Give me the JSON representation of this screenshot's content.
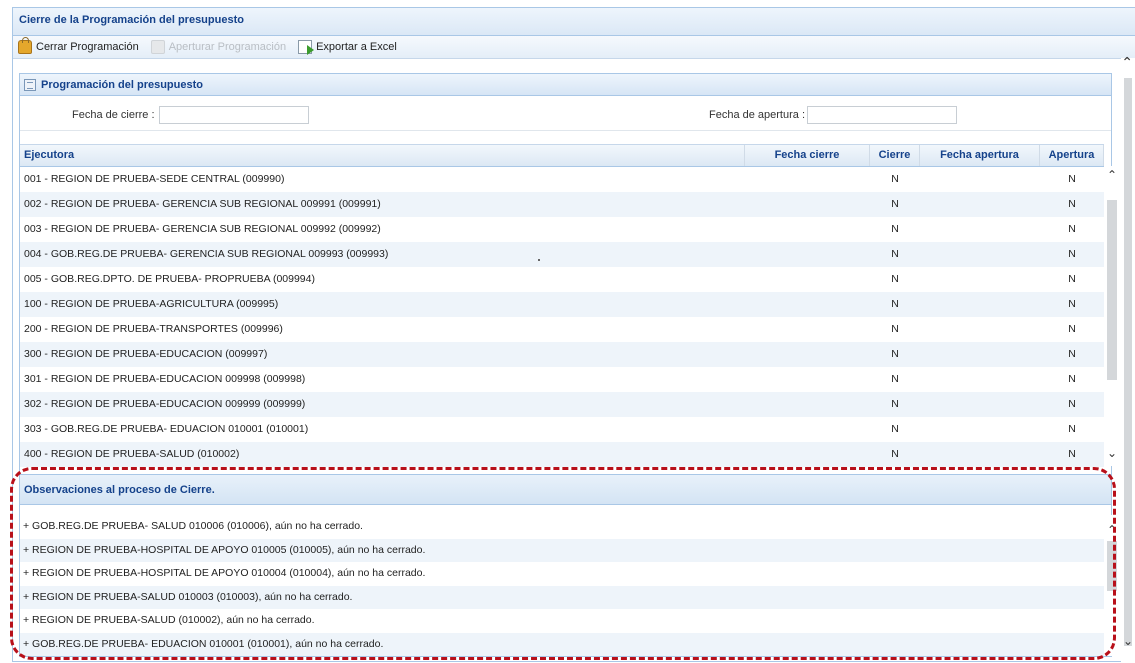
{
  "window": {
    "title": "Cierre de la Programación del presupuesto"
  },
  "toolbar": {
    "cerrar": "Cerrar Programación",
    "aperturar": "Aperturar Programación",
    "exportar": "Exportar a Excel"
  },
  "panel": {
    "title": "Programación del presupuesto"
  },
  "dates": {
    "cierre_label": "Fecha de cierre :",
    "cierre_value": "",
    "apertura_label": "Fecha de apertura :",
    "apertura_value": ""
  },
  "grid": {
    "columns": [
      "Ejecutora",
      "Fecha cierre",
      "Cierre",
      "Fecha apertura",
      "Apertura"
    ],
    "rows": [
      {
        "ejecutora": "001 - REGION DE PRUEBA-SEDE CENTRAL (009990)",
        "fecha_cierre": "",
        "cierre": "N",
        "fecha_apertura": "",
        "apertura": "N"
      },
      {
        "ejecutora": "002 - REGION DE PRUEBA- GERENCIA SUB REGIONAL 009991 (009991)",
        "fecha_cierre": "",
        "cierre": "N",
        "fecha_apertura": "",
        "apertura": "N"
      },
      {
        "ejecutora": "003 - REGION DE PRUEBA- GERENCIA SUB REGIONAL 009992 (009992)",
        "fecha_cierre": "",
        "cierre": "N",
        "fecha_apertura": "",
        "apertura": "N"
      },
      {
        "ejecutora": "004 - GOB.REG.DE PRUEBA- GERENCIA SUB REGIONAL 009993 (009993)",
        "fecha_cierre": "",
        "cierre": "N",
        "fecha_apertura": "",
        "apertura": "N"
      },
      {
        "ejecutora": "005 - GOB.REG.DPTO. DE PRUEBA- PROPRUEBA (009994)",
        "fecha_cierre": "",
        "cierre": "N",
        "fecha_apertura": "",
        "apertura": "N"
      },
      {
        "ejecutora": "100 - REGION DE PRUEBA-AGRICULTURA (009995)",
        "fecha_cierre": "",
        "cierre": "N",
        "fecha_apertura": "",
        "apertura": "N"
      },
      {
        "ejecutora": "200 - REGION DE PRUEBA-TRANSPORTES (009996)",
        "fecha_cierre": "",
        "cierre": "N",
        "fecha_apertura": "",
        "apertura": "N"
      },
      {
        "ejecutora": "300 - REGION DE PRUEBA-EDUCACION (009997)",
        "fecha_cierre": "",
        "cierre": "N",
        "fecha_apertura": "",
        "apertura": "N"
      },
      {
        "ejecutora": "301 - REGION DE PRUEBA-EDUCACION 009998 (009998)",
        "fecha_cierre": "",
        "cierre": "N",
        "fecha_apertura": "",
        "apertura": "N"
      },
      {
        "ejecutora": "302 - REGION DE PRUEBA-EDUCACION 009999 (009999)",
        "fecha_cierre": "",
        "cierre": "N",
        "fecha_apertura": "",
        "apertura": "N"
      },
      {
        "ejecutora": "303 - GOB.REG.DE PRUEBA- EDUACION 010001 (010001)",
        "fecha_cierre": "",
        "cierre": "N",
        "fecha_apertura": "",
        "apertura": "N"
      },
      {
        "ejecutora": "400 - REGION DE PRUEBA-SALUD (010002)",
        "fecha_cierre": "",
        "cierre": "N",
        "fecha_apertura": "",
        "apertura": "N"
      }
    ]
  },
  "observaciones": {
    "title": "Observaciones al proceso de Cierre.",
    "items": [
      "+ GOB.REG.DE PRUEBA- SALUD 010006 (010006), aún no ha cerrado.",
      "+ REGION DE PRUEBA-HOSPITAL DE APOYO 010005 (010005), aún no ha cerrado.",
      "+ REGION DE PRUEBA-HOSPITAL DE APOYO 010004 (010004), aún no ha cerrado.",
      "+ REGION DE PRUEBA-SALUD 010003 (010003), aún no ha cerrado.",
      "+ REGION DE PRUEBA-SALUD (010002), aún no ha cerrado.",
      "+ GOB.REG.DE PRUEBA- EDUACION 010001 (010001), aún no ha cerrado."
    ]
  },
  "colors": {
    "header_text": "#15428b",
    "highlight": "#b8101a",
    "border": "#a9c7e6"
  }
}
